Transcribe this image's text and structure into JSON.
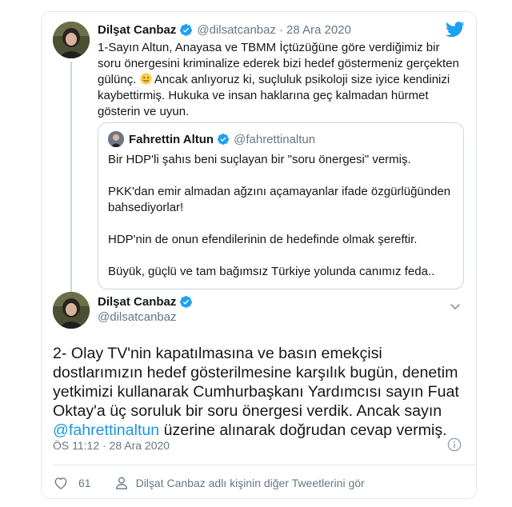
{
  "context_tweet": {
    "author_name": "Dilşat Canbaz",
    "author_handle": "@dilsatcanbaz",
    "separator": "·",
    "date": "28 Ara 2020",
    "text_part1": "1-Sayın Altun, Anayasa ve TBMM İçtüzüğüne göre verdiğimiz bir soru önergesini kriminalize ederek bizi hedef göstermeniz gerçekten gülünç. ",
    "emoji": "slightly-smiling-face",
    "text_part2": " Ancak anlıyoruz ki, suçluluk psikoloji size iyice kendinizi kaybettirmiş. Hukuka ve insan haklarına geç kalmadan hürmet gösterin ve uyun."
  },
  "quoted_tweet": {
    "author_name": "Fahrettin Altun",
    "author_handle": "@fahrettinaltun",
    "paragraphs": [
      "Bir HDP'li şahıs beni suçlayan bir \"soru önergesi\" vermiş.",
      "PKK'dan emir almadan ağzını açamayanlar ifade özgürlüğünden bahsediyorlar!",
      "HDP'nin de onun efendilerinin de hedefinde olmak şereftir.",
      "Büyük, güçlü ve tam bağımsız Türkiye yolunda canımız feda.."
    ]
  },
  "main_tweet": {
    "author_name": "Dilşat Canbaz",
    "author_handle": "@dilsatcanbaz",
    "text_before_mention": "2- Olay TV'nin kapatılmasına ve basın emekçisi dostlarımızın hedef gösterilmesine karşılık bugün, denetim yetkimizi kullanarak Cumhurbaşkanı Yardımcısı sayın Fuat Oktay'a üç soruluk bir soru önergesi verdik. Ancak sayın ",
    "mention": "@fahrettinaltun",
    "text_after_mention": " üzerine alınarak doğrudan cevap vermiş.",
    "timestamp": "ÖS 11:12 · 28 Ara 2020",
    "like_count": "61",
    "more_tweets_link": "Dilşat Canbaz adlı kişinin diğer Tweetlerini gör"
  },
  "icons": {
    "brand": "twitter-bird-icon",
    "verified": "verified-badge-icon",
    "chevron": "chevron-down-icon",
    "info": "info-icon",
    "like": "heart-icon",
    "profile": "person-icon"
  },
  "colors": {
    "twitter_blue": "#1da1f2",
    "link_blue": "#1b95e0",
    "text": "#14171a",
    "muted": "#657786",
    "border": "#e1e8ed"
  }
}
